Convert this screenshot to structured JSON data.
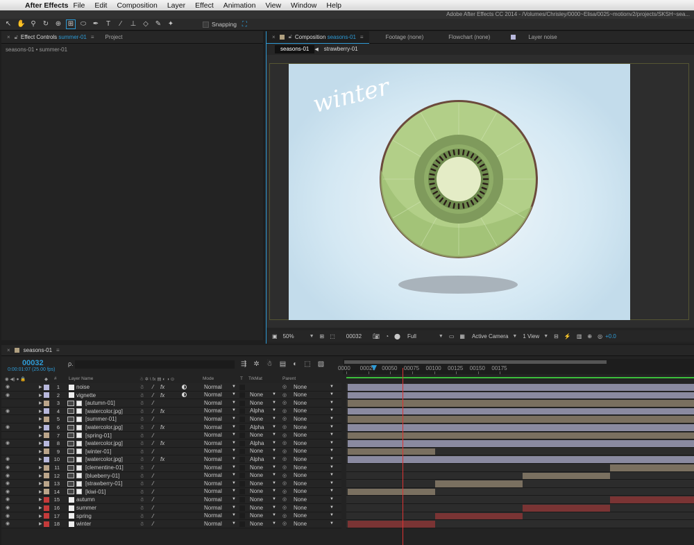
{
  "menubar": {
    "app_name": "After Effects",
    "items": [
      "File",
      "Edit",
      "Composition",
      "Layer",
      "Effect",
      "Animation",
      "View",
      "Window",
      "Help"
    ]
  },
  "title_bar": {
    "text": "Adobe After Effects CC 2014 - /Volumes/Chrisley/0000~Elisa/0025~motionv2/projects/SKSH~sea..."
  },
  "toolbar": {
    "tools": [
      "selection-tool",
      "hand-tool",
      "zoom-tool",
      "rotation-tool",
      "camera-orbit-tool",
      "pan-behind-tool",
      "ellipse-tool",
      "pen-tool",
      "type-tool",
      "brush-tool",
      "clone-stamp-tool",
      "eraser-tool",
      "roto-brush-tool",
      "puppet-pin-tool"
    ],
    "snapping_label": "Snapping"
  },
  "effect_controls_panel": {
    "tab_label": "Effect Controls",
    "tab_layer": "summer-01",
    "project_tab": "Project",
    "breadcrumb": "seasons-01 • summer-01"
  },
  "composition_panel": {
    "tab_label": "Composition",
    "tab_comp": "seasons-01",
    "footage_tab": "Footage (none)",
    "flowchart_tab": "Flowchart (none)",
    "layer_tab": "Layer noise",
    "subtabs": [
      "seasons-01",
      "strawberry-01"
    ],
    "canvas_text": "winter",
    "footer": {
      "zoom": "50%",
      "current_frame": "00032",
      "resolution": "Full",
      "camera": "Active Camera",
      "views": "1 View",
      "exposure": "+0.0"
    }
  },
  "timeline": {
    "tab_label": "seasons-01",
    "timecode": "00032",
    "timecode_sub": "0:00:01:07 (25.00 fps)",
    "search_icon_text": "ρ.",
    "ruler_ticks": [
      "0000",
      "00025",
      "00050",
      "00075",
      "00100",
      "00125",
      "00150",
      "00175"
    ],
    "current_frame": 32,
    "column_headers": {
      "switches": "◉ ◀) ● 🔒",
      "label": "◆",
      "num": "#",
      "layer_name": "Layer Name",
      "mode": "Mode",
      "t": "T",
      "trkmat": "TrkMat",
      "parent": "Parent"
    },
    "layers": [
      {
        "num": "1",
        "name": "noise",
        "label_color": "#b8b8dc",
        "type": "solid",
        "fx": true,
        "adj": true,
        "mode": "Normal",
        "trkmat": "",
        "parent": "None",
        "eye": true,
        "bar": {
          "start": 0,
          "end": 200,
          "color": "#8a8aa0"
        }
      },
      {
        "num": "2",
        "name": "vignette",
        "label_color": "#b8b8dc",
        "type": "solid",
        "fx": true,
        "adj": true,
        "mode": "Normal",
        "trkmat": "None",
        "parent": "None",
        "eye": true,
        "bar": {
          "start": 0,
          "end": 200,
          "color": "#8a8aa0"
        }
      },
      {
        "num": "3",
        "name": "[autumn-01]",
        "label_color": "#bba58a",
        "type": "precomp",
        "fx": false,
        "adj": false,
        "mode": "Normal",
        "trkmat": "None",
        "parent": "None",
        "eye": false,
        "bar": {
          "start": 0,
          "end": 200,
          "color": "#7a7060"
        }
      },
      {
        "num": "4",
        "name": "[watercolor.jpg]",
        "label_color": "#b8b8dc",
        "type": "footage",
        "fx": true,
        "adj": false,
        "mode": "Normal",
        "trkmat": "Alpha",
        "parent": "None",
        "eye": true,
        "bar": {
          "start": 0,
          "end": 200,
          "color": "#8a8aa0"
        }
      },
      {
        "num": "5",
        "name": "[summer-01]",
        "label_color": "#bba58a",
        "type": "precomp",
        "fx": false,
        "adj": false,
        "mode": "Normal",
        "trkmat": "None",
        "parent": "None",
        "eye": false,
        "bar": {
          "start": 0,
          "end": 200,
          "color": "#7a7060"
        }
      },
      {
        "num": "6",
        "name": "[watercolor.jpg]",
        "label_color": "#b8b8dc",
        "type": "footage",
        "fx": true,
        "adj": false,
        "mode": "Normal",
        "trkmat": "Alpha",
        "parent": "None",
        "eye": true,
        "bar": {
          "start": 0,
          "end": 200,
          "color": "#8a8aa0"
        }
      },
      {
        "num": "7",
        "name": "[spring-01]",
        "label_color": "#bba58a",
        "type": "precomp",
        "fx": false,
        "adj": false,
        "mode": "Normal",
        "trkmat": "None",
        "parent": "None",
        "eye": false,
        "bar": {
          "start": 0,
          "end": 200,
          "color": "#7a7060"
        }
      },
      {
        "num": "8",
        "name": "[watercolor.jpg]",
        "label_color": "#b8b8dc",
        "type": "footage",
        "fx": true,
        "adj": false,
        "mode": "Normal",
        "trkmat": "Alpha",
        "parent": "None",
        "eye": true,
        "bar": {
          "start": 0,
          "end": 200,
          "color": "#8a8aa0"
        }
      },
      {
        "num": "9",
        "name": "[winter-01]",
        "label_color": "#bba58a",
        "type": "precomp",
        "fx": false,
        "adj": false,
        "mode": "Normal",
        "trkmat": "None",
        "parent": "None",
        "eye": false,
        "bar": {
          "start": 0,
          "end": 50,
          "color": "#7a7060"
        }
      },
      {
        "num": "10",
        "name": "[watercolor.jpg]",
        "label_color": "#b8b8dc",
        "type": "footage",
        "fx": true,
        "adj": false,
        "mode": "Normal",
        "trkmat": "Alpha",
        "parent": "None",
        "eye": true,
        "bar": {
          "start": 0,
          "end": 200,
          "color": "#8a8aa0"
        }
      },
      {
        "num": "11",
        "name": "[clementine-01]",
        "label_color": "#bba58a",
        "type": "precomp",
        "fx": false,
        "adj": false,
        "mode": "Normal",
        "trkmat": "None",
        "parent": "None",
        "eye": true,
        "bar": {
          "start": 150,
          "end": 200,
          "color": "#7a7060"
        }
      },
      {
        "num": "12",
        "name": "[blueberry-01]",
        "label_color": "#bba58a",
        "type": "precomp",
        "fx": false,
        "adj": false,
        "mode": "Normal",
        "trkmat": "None",
        "parent": "None",
        "eye": true,
        "bar": {
          "start": 100,
          "end": 150,
          "color": "#7a7060"
        }
      },
      {
        "num": "13",
        "name": "[strawberry-01]",
        "label_color": "#bba58a",
        "type": "precomp",
        "fx": false,
        "adj": false,
        "mode": "Normal",
        "trkmat": "None",
        "parent": "None",
        "eye": true,
        "bar": {
          "start": 50,
          "end": 100,
          "color": "#7a7060"
        }
      },
      {
        "num": "14",
        "name": "[kiwi-01]",
        "label_color": "#bba58a",
        "type": "precomp",
        "fx": false,
        "adj": false,
        "mode": "Normal",
        "trkmat": "None",
        "parent": "None",
        "eye": true,
        "bar": {
          "start": 0,
          "end": 50,
          "color": "#7a7060"
        }
      },
      {
        "num": "15",
        "name": "autumn",
        "label_color": "#c43a3a",
        "type": "text",
        "fx": false,
        "adj": false,
        "mode": "Normal",
        "trkmat": "None",
        "parent": "None",
        "eye": true,
        "bar": {
          "start": 150,
          "end": 200,
          "color": "#7a3434"
        }
      },
      {
        "num": "16",
        "name": "summer",
        "label_color": "#c43a3a",
        "type": "text",
        "fx": false,
        "adj": false,
        "mode": "Normal",
        "trkmat": "None",
        "parent": "None",
        "eye": true,
        "bar": {
          "start": 100,
          "end": 150,
          "color": "#7a3434"
        }
      },
      {
        "num": "17",
        "name": "spring",
        "label_color": "#c43a3a",
        "type": "text",
        "fx": false,
        "adj": false,
        "mode": "Normal",
        "trkmat": "None",
        "parent": "None",
        "eye": true,
        "bar": {
          "start": 50,
          "end": 100,
          "color": "#7a3434"
        }
      },
      {
        "num": "18",
        "name": "winter",
        "label_color": "#c43a3a",
        "type": "text",
        "fx": false,
        "adj": false,
        "mode": "Normal",
        "trkmat": "None",
        "parent": "None",
        "eye": true,
        "bar": {
          "start": 0,
          "end": 50,
          "color": "#7a3434"
        }
      }
    ]
  },
  "colors": {
    "accent": "#2e9bd6",
    "cti": "#dd3333",
    "work_area": "#3cbf3c"
  }
}
